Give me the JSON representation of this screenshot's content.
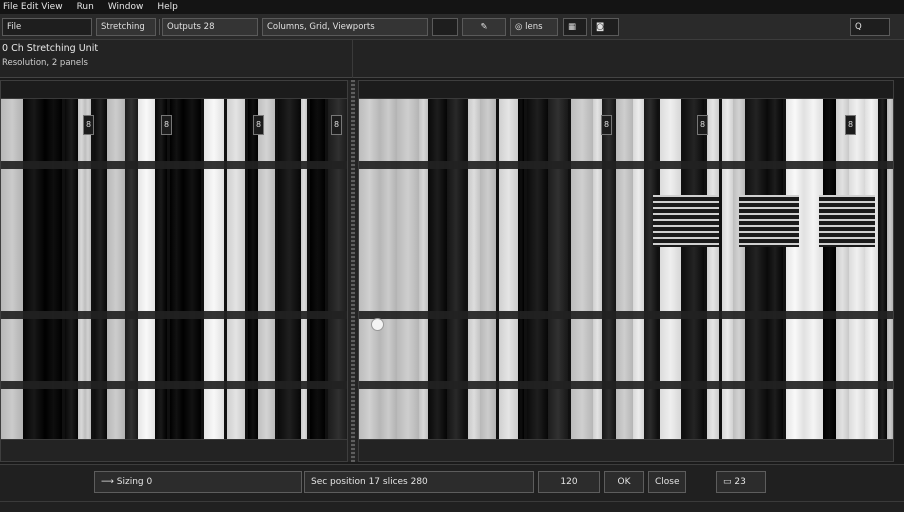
{
  "menu": {
    "items": [
      "File Edit View",
      "Run",
      "Window",
      "Help"
    ]
  },
  "toolbar": {
    "left_label": "File",
    "mode_label": "Stretching",
    "zoom_label": "Outputs 28",
    "layout_label": "Columns, Grid, Viewports",
    "tool_glyph": "✎",
    "icon_label": "lens",
    "search_glyph": "Q"
  },
  "info": {
    "line1": "0 Ch  Stretching Unit",
    "line2": "Resolution, 2 panels"
  },
  "left_panel": {
    "badges": [
      "8",
      "8",
      "8",
      "8"
    ]
  },
  "right_panel": {
    "badges": [
      "8",
      "8",
      "8"
    ]
  },
  "status": {
    "left_field": "Sizing  0",
    "mid_field": "Sec position  17 slices 280",
    "num_field": "120",
    "ok_label": "OK",
    "cancel_label": "Close",
    "page_label": "23"
  },
  "colors": {
    "background": "#1a1a1a",
    "panel": "#262626",
    "bar_light": "#e9e9e9",
    "bar_dark": "#141414"
  }
}
